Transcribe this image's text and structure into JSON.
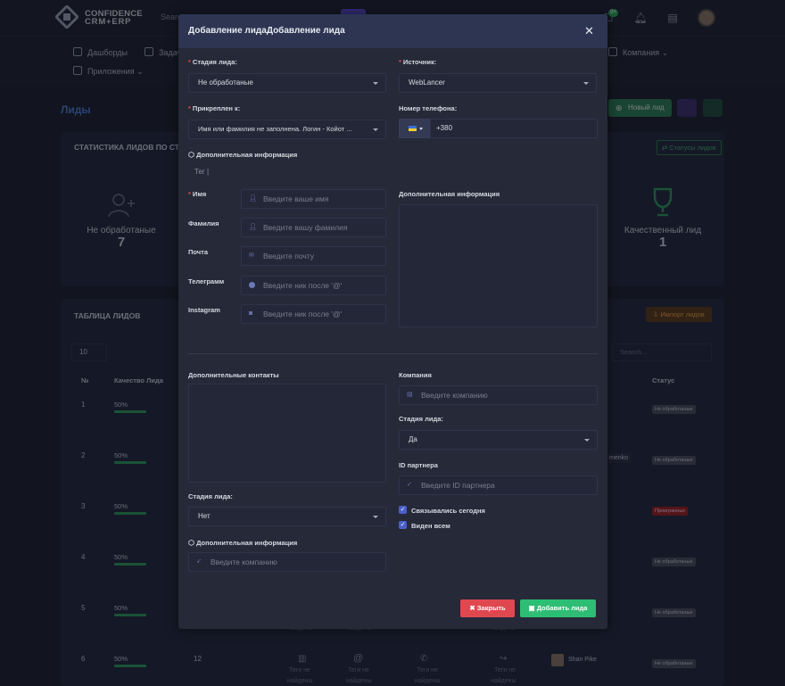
{
  "app": {
    "logo_line1": "CONFIDENCE",
    "logo_line2": "CRM+ERP",
    "search_placeholder": "Search",
    "notification_badge": "9+"
  },
  "nav": {
    "items": [
      "Дашборды",
      "Задачи",
      "Компания",
      "Приложения"
    ]
  },
  "page": {
    "title": "Лиды",
    "new_lead_button": "Новый лид"
  },
  "stats": {
    "title": "СТАТИСТИКА ЛИДОВ ПО СТАТУСАМ",
    "statuses_button": "Статусы лидов",
    "items": [
      {
        "label": "Не обработаные",
        "count": "7"
      },
      {
        "label": "Качественный лид",
        "count": "1"
      }
    ]
  },
  "table": {
    "title": "ТАБЛИЦА ЛИДОВ",
    "import_button": "Импорт лидов",
    "page_size": "10",
    "search_placeholder": "Search...",
    "columns": {
      "no": "№",
      "quality": "Качество Лида",
      "status": "Статус"
    },
    "rows": [
      {
        "no": "1",
        "quality": "50%",
        "status": "Не обработаные",
        "status_color": "#4a4d5c"
      },
      {
        "no": "2",
        "quality": "50%",
        "status": "Не обработаные",
        "status_color": "#4a4d5c"
      },
      {
        "no": "3",
        "quality": "50%",
        "status": "Проигранных",
        "status_color": "#a01f23"
      },
      {
        "no": "4",
        "quality": "50%",
        "status": "Не обработаные",
        "status_color": "#4a4d5c"
      },
      {
        "no": "5",
        "quality": "50%",
        "status": "Не обработаные",
        "status_color": "#4a4d5c"
      },
      {
        "no": "6",
        "quality": "50%",
        "status": "Не обработаные",
        "status_color": "#4a4d5c",
        "id": "12",
        "manager": "Shan Pike"
      }
    ],
    "partial_manager_text": "menko",
    "tags_not_found_line1": "Теги не",
    "tags_not_found_line2": "найдены"
  },
  "modal": {
    "title": "Добавление лидаДобавление лида",
    "stage_label": "Стадия лида:",
    "stage_value": "Не обработаные",
    "source_label": "Источник:",
    "source_value": "WebLancer",
    "assigned_label": "Прикреплен к:",
    "assigned_value": "Имя или фамилия не заполнена. Логин - Койот ...",
    "phone_label": "Номер телефона:",
    "phone_value": "+380",
    "extra_info_label": "Дополнительная информация",
    "tag_placeholder": "Тег |",
    "first_name_label": "Имя",
    "first_name_placeholder": "Введите ваше имя",
    "last_name_label": "Фамилия",
    "last_name_placeholder": "Введите вашу фамилия",
    "email_label": "Почта",
    "email_placeholder": "Введите почту",
    "telegram_label": "Телеграмм",
    "telegram_placeholder": "Введите ник после '@'",
    "instagram_label": "Instagram",
    "instagram_placeholder": "Введите ник после '@'",
    "right_extra_info_label": "Дополнительная информация",
    "extra_contacts_label": "Дополнительные контакты",
    "company_label": "Компания",
    "company_placeholder": "Введите компанию",
    "stage2_label": "Стадия лида:",
    "stage2_value": "Да",
    "partner_label": "ID партнера",
    "partner_placeholder": "Введите ID партнера",
    "stage3_label": "Стадия лида:",
    "stage3_value": "Нет",
    "contacted_today_label": "Связывались сегодня",
    "visible_all_label": "Виден всем",
    "extra_info2_label": "Дополнительная информация",
    "extra_company_placeholder": "Введите компанию",
    "close_button": "Закрыть",
    "add_button": "Добавить лида"
  },
  "colors": {
    "accent": "#4b7fd6",
    "primary_green": "#2ebd74",
    "danger": "#e04850",
    "modal_header": "#2d3552"
  }
}
